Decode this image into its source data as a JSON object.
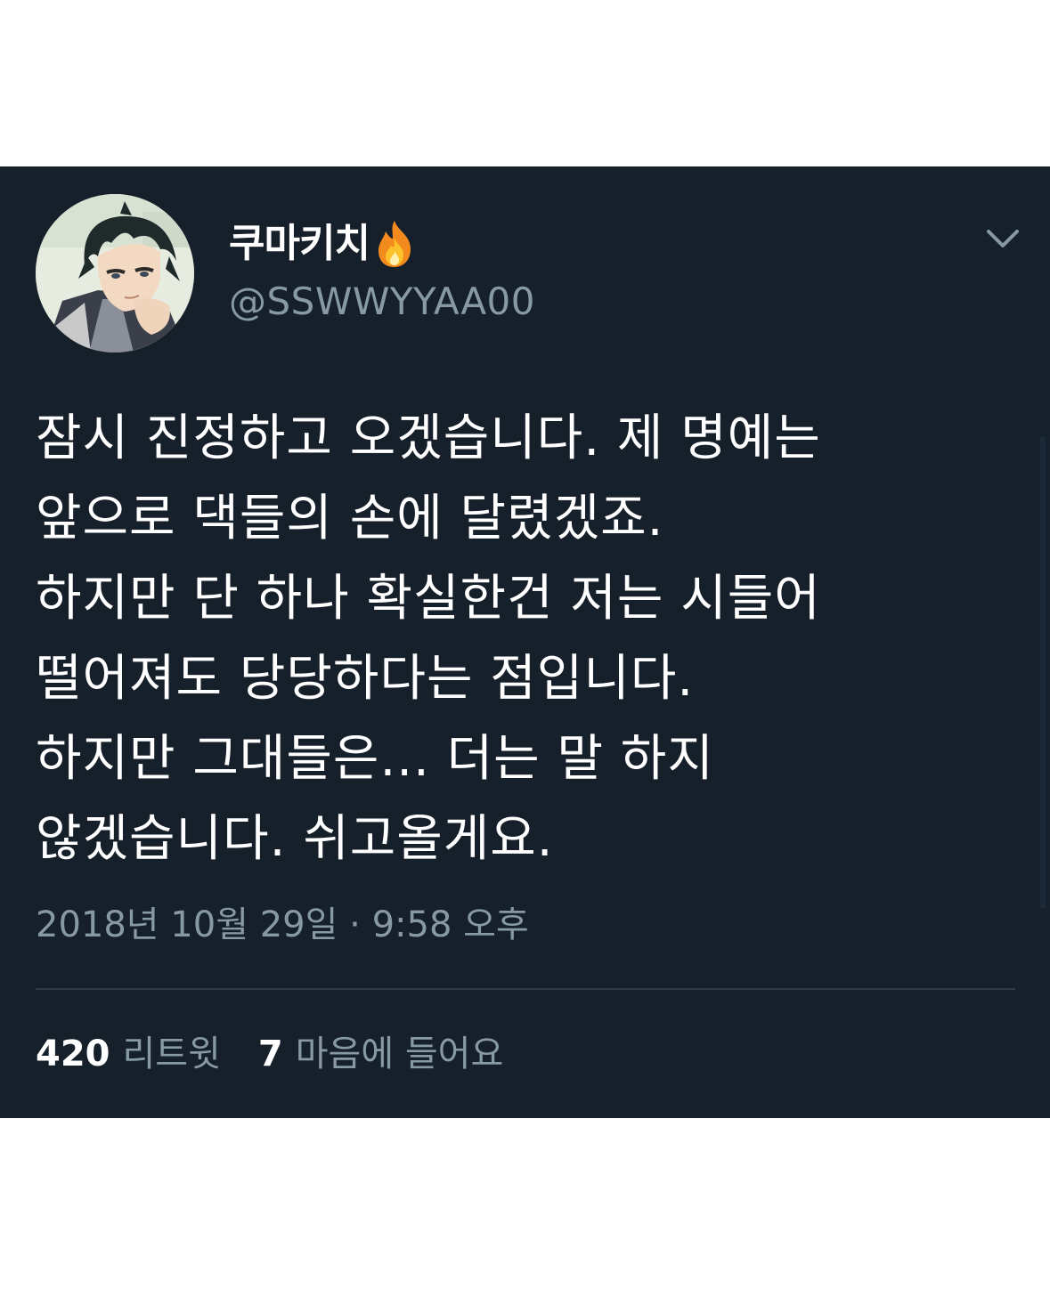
{
  "tweet": {
    "display_name": "쿠마키치",
    "handle": "@SSWWYYAA00",
    "body_lines": [
      "잠시 진정하고 오겠습니다. 제 명예는",
      "앞으로 댁들의 손에 달렸겠죠.",
      "하지만 단 하나 확실한건 저는 시들어",
      "떨어져도 당당하다는 점입니다.",
      "하지만 그대들은... 더는 말 하지",
      "않겠습니다. 쉬고올게요."
    ],
    "timestamp": "2018년 10월 29일 · 9:58 오후",
    "stats": {
      "retweets_count": "420",
      "retweets_label": "리트윗",
      "likes_count": "7",
      "likes_label": "마음에 들어요"
    }
  },
  "colors": {
    "background": "#16202b",
    "primary_text": "#ffffff",
    "secondary_text": "#8899a6",
    "divider": "#2f3b47"
  },
  "icons": {
    "badge": "fire-icon",
    "menu": "chevron-down-icon",
    "avatar": "avatar"
  }
}
